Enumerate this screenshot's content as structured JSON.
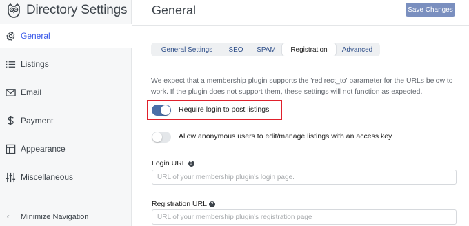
{
  "app": {
    "title": "Directory Settings",
    "logo_icon": "owl-logo-icon"
  },
  "sidebar": {
    "items": [
      {
        "label": "General",
        "icon": "gear-icon",
        "active": true
      },
      {
        "label": "Listings",
        "icon": "list-icon",
        "active": false
      },
      {
        "label": "Email",
        "icon": "envelope-icon",
        "active": false
      },
      {
        "label": "Payment",
        "icon": "dollar-icon",
        "active": false
      },
      {
        "label": "Appearance",
        "icon": "layout-icon",
        "active": false
      },
      {
        "label": "Miscellaneous",
        "icon": "sliders-icon",
        "active": false
      }
    ],
    "minimize_label": "Minimize Navigation",
    "minimize_icon": "chevron-left-icon"
  },
  "header": {
    "title": "General",
    "save_label": "Save Changes"
  },
  "tabs": [
    {
      "label": "General Settings",
      "active": false
    },
    {
      "label": "SEO",
      "active": false
    },
    {
      "label": "SPAM",
      "active": false
    },
    {
      "label": "Registration",
      "active": true
    },
    {
      "label": "Advanced",
      "active": false
    }
  ],
  "registration": {
    "notice": "We expect that a membership plugin supports the 'redirect_to' parameter for the URLs below to work. If the plugin does not support them, these settings will not function as expected.",
    "require_login": {
      "label": "Require login to post listings",
      "enabled": true
    },
    "anonymous_edit": {
      "label": "Allow anonymous users to edit/manage listings with an access key",
      "enabled": false
    },
    "login_url": {
      "label": "Login URL",
      "value": "",
      "placeholder": "URL of your membership plugin's login page."
    },
    "registration_url": {
      "label": "Registration URL",
      "value": "",
      "placeholder": "URL of your membership plugin's registration page"
    }
  },
  "colors": {
    "accent": "#3858e9",
    "save_button": "#7a8fbf",
    "toggle_on": "#4b6fa8",
    "highlight_border": "#e0212c"
  }
}
